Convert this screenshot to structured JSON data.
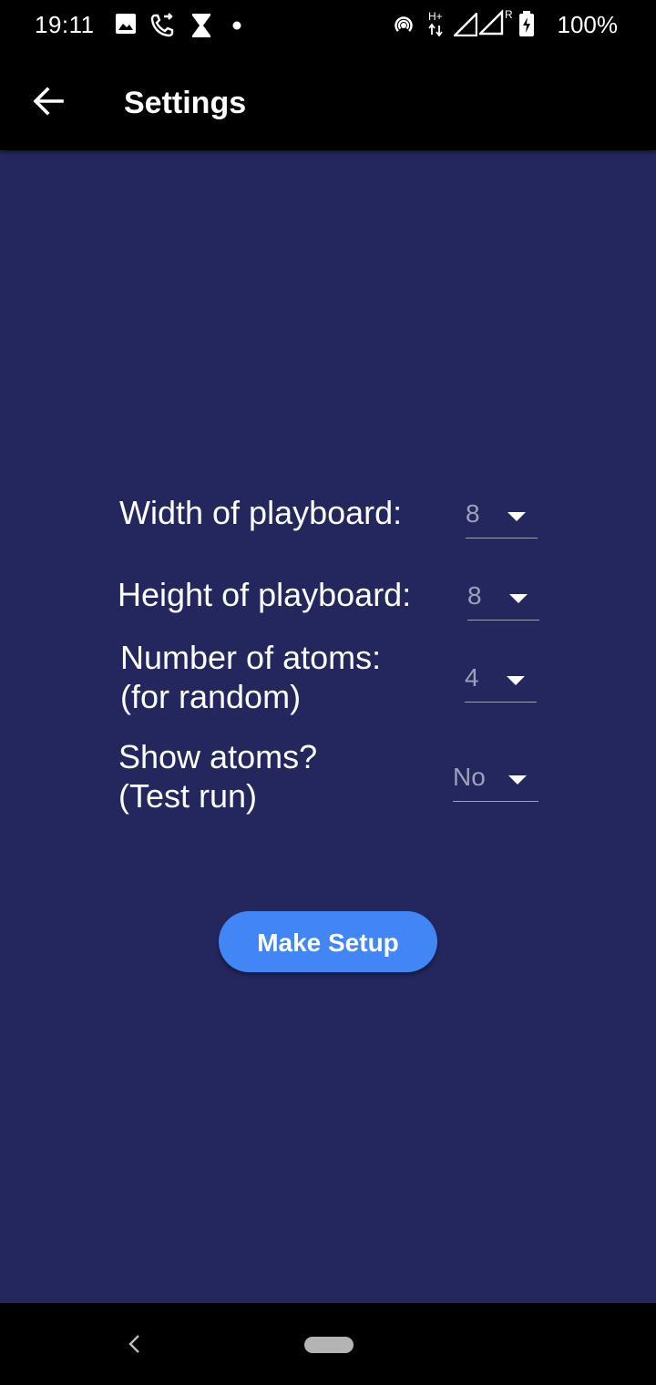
{
  "status_bar": {
    "time": "19:11",
    "battery": "100%",
    "left_icons": [
      "image-icon",
      "call-forward-icon",
      "hourglass-icon",
      "dot-icon"
    ],
    "right_icons": [
      "hotspot-icon",
      "hplus-data-icon",
      "signal-icon",
      "signal-roaming-icon",
      "battery-charging-icon"
    ],
    "hplus_text": "H+",
    "roaming_text": "R"
  },
  "app_bar": {
    "title": "Settings",
    "back_icon": "arrow-back-icon"
  },
  "settings": {
    "width": {
      "label": "Width of playboard:",
      "value": "8"
    },
    "height": {
      "label": "Height of playboard:",
      "value": "8"
    },
    "atoms": {
      "label": "Number of atoms:\n(for random)",
      "value": "4"
    },
    "show": {
      "label": "Show atoms?\n(Test run)",
      "value": "No"
    }
  },
  "actions": {
    "make_setup": "Make Setup"
  },
  "colors": {
    "background": "#23275e",
    "bars": "#000000",
    "button": "#4285f4",
    "dropdown_value": "#9ea0ba"
  }
}
